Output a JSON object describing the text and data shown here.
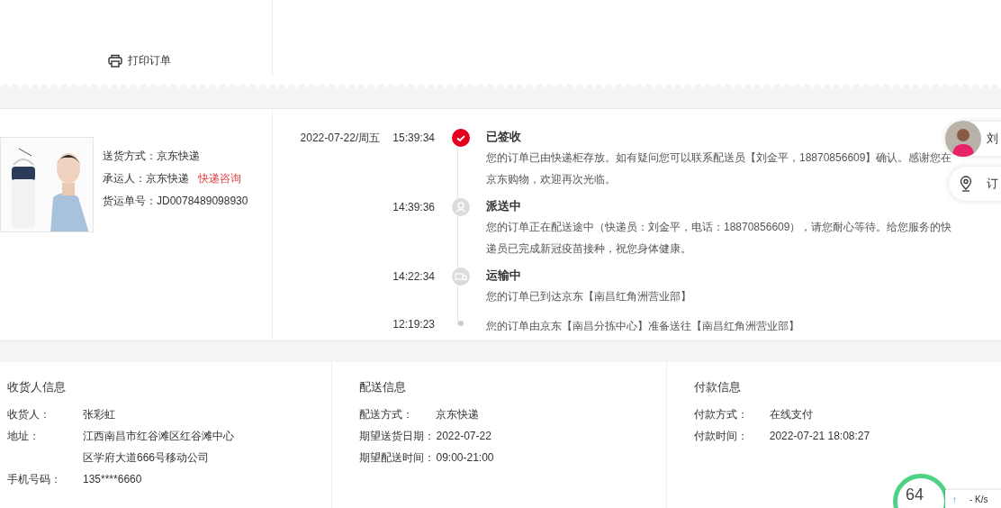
{
  "print_button": {
    "label": "打印订单"
  },
  "shipment": {
    "lines": [
      {
        "label": "送货方式：",
        "value": "京东快递"
      },
      {
        "label": "承运人：",
        "value": "京东快递",
        "link": "快递咨询"
      },
      {
        "label": "货运单号：",
        "value": "JD0078489098930"
      }
    ]
  },
  "tracking": [
    {
      "kind": "signed",
      "date": "2022-07-22/周五",
      "time": "15:39:34",
      "title": "已签收",
      "text": "您的订单已由快递柜存放。如有疑问您可以联系配送员【刘金平，18870856609】确认。感谢您在京东购物，欢迎再次光临。"
    },
    {
      "kind": "delivering",
      "time": "14:39:36",
      "title": "派送中",
      "text": "您的订单正在配送途中（快递员：刘金平，电话：18870856609），请您耐心等待。给您服务的快递员已完成新冠疫苗接种，祝您身体健康。"
    },
    {
      "kind": "transport",
      "time": "14:22:34",
      "title": "运输中",
      "text": "您的订单已到达京东【南昌红角洲营业部】"
    },
    {
      "kind": "dot",
      "time": "12:19:23",
      "text": "您的订单由京东【南昌分拣中心】准备送往【南昌红角洲营业部】"
    }
  ],
  "float_buttons": [
    {
      "kind": "avatar",
      "label": "刘"
    },
    {
      "kind": "location",
      "label": "订"
    }
  ],
  "info_sections": [
    {
      "title": "收货人信息",
      "rows": [
        {
          "label": "收货人：",
          "value": "张彩虹"
        },
        {
          "label": "地址：",
          "value": "江西南昌市红谷滩区红谷滩中心区学府大道666号移动公司"
        },
        {
          "label": "手机号码：",
          "value": "135****6660"
        }
      ]
    },
    {
      "title": "配送信息",
      "rows": [
        {
          "label": "配送方式：",
          "value": "京东快递"
        },
        {
          "label": "期望送货日期：",
          "value": "2022-07-22"
        },
        {
          "label": "期望配送时间：",
          "value": "09:00-21:00"
        }
      ]
    },
    {
      "title": "付款信息",
      "rows": [
        {
          "label": "付款方式：",
          "value": "在线支付"
        },
        {
          "label": "付款时间：",
          "value": "2022-07-21 18:08:27"
        }
      ]
    }
  ],
  "speed_widget": {
    "score": "64",
    "upload": "↑",
    "rate": "- K/s"
  }
}
